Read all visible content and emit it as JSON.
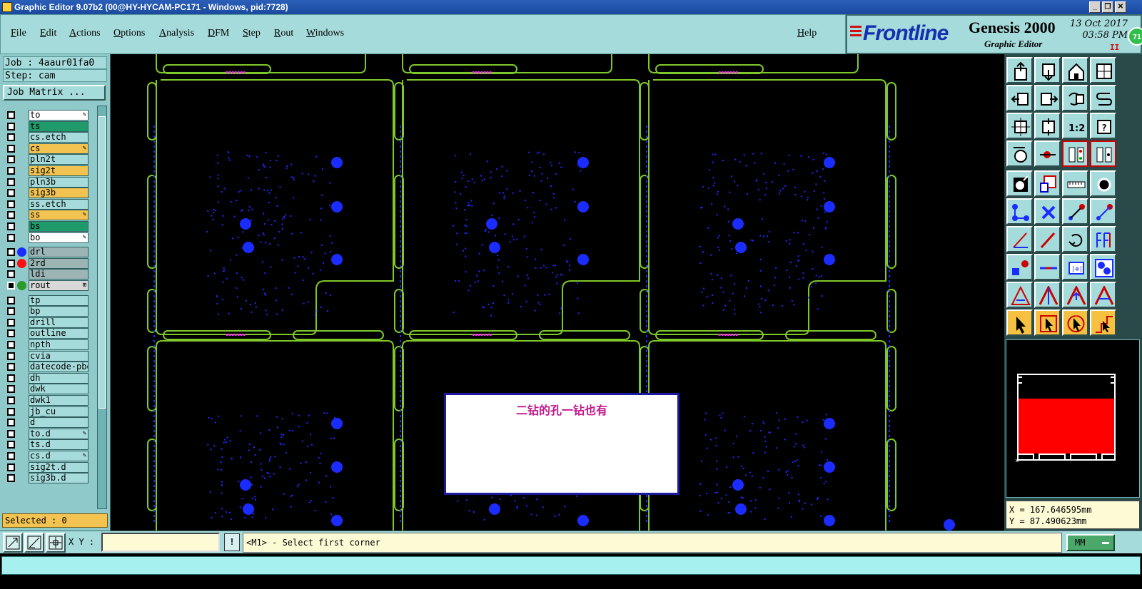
{
  "window": {
    "title": "Graphic Editor 9.07b2 (00@HY-HYCAM-PC171 - Windows, pid:7728)",
    "buttons": [
      "_",
      "❐",
      "✕"
    ]
  },
  "menu": {
    "items": [
      "File",
      "Edit",
      "Actions",
      "Options",
      "Analysis",
      "DFM",
      "Step",
      "Rout",
      "Windows"
    ],
    "help": "Help"
  },
  "brand": {
    "logo": "Frontline",
    "product": "Genesis 2000",
    "subtitle": "Graphic Editor",
    "date": "13 Oct 2017",
    "time": "03:58 PM",
    "pause": "II",
    "badge": "71"
  },
  "job": {
    "job_label": "Job : 4aaur01fa0",
    "step_label": "Step: cam",
    "matrix_button": "Job Matrix ..."
  },
  "layers": [
    {
      "name": "to",
      "bg": "#ffffff",
      "mark": "✎",
      "dot": ""
    },
    {
      "name": "ts",
      "bg": "#1f9a6a",
      "mark": "",
      "dot": ""
    },
    {
      "name": "cs.etch",
      "bg": "#a6dbdb",
      "mark": "",
      "dot": ""
    },
    {
      "name": "cs",
      "bg": "#f2c351",
      "mark": "✎",
      "dot": ""
    },
    {
      "name": "pln2t",
      "bg": "#a6dbdb",
      "mark": "",
      "dot": ""
    },
    {
      "name": "sig2t",
      "bg": "#f2c351",
      "mark": "",
      "dot": ""
    },
    {
      "name": "pln3b",
      "bg": "#a6dbdb",
      "mark": "",
      "dot": ""
    },
    {
      "name": "sig3b",
      "bg": "#f2c351",
      "mark": "",
      "dot": ""
    },
    {
      "name": "ss.etch",
      "bg": "#a6dbdb",
      "mark": "",
      "dot": ""
    },
    {
      "name": "ss",
      "bg": "#f2c351",
      "mark": "✎",
      "dot": ""
    },
    {
      "name": "bs",
      "bg": "#1f9a6a",
      "mark": "",
      "dot": ""
    },
    {
      "name": "bo",
      "bg": "#ffffff",
      "mark": "✎",
      "dot": ""
    },
    {
      "name": "drl",
      "bg": "#9cb4b4",
      "mark": "",
      "dot": "#1a2cff"
    },
    {
      "name": "2rd",
      "bg": "#9cb4b4",
      "mark": "",
      "dot": "#ff1010"
    },
    {
      "name": "ldi",
      "bg": "#9cb4b4",
      "mark": "",
      "dot": ""
    },
    {
      "name": "rout",
      "bg": "#d8d8d8",
      "mark": "⊞",
      "dot": "#2a9a2a"
    },
    {
      "name": "tp",
      "bg": "#a6dbdb",
      "mark": "",
      "dot": ""
    },
    {
      "name": "bp",
      "bg": "#a6dbdb",
      "mark": "",
      "dot": ""
    },
    {
      "name": "drill",
      "bg": "#a6dbdb",
      "mark": "",
      "dot": ""
    },
    {
      "name": "outline",
      "bg": "#a6dbdb",
      "mark": "",
      "dot": ""
    },
    {
      "name": "npth",
      "bg": "#a6dbdb",
      "mark": "",
      "dot": ""
    },
    {
      "name": "cvia",
      "bg": "#a6dbdb",
      "mark": "",
      "dot": ""
    },
    {
      "name": "datecode-pbe",
      "bg": "#a6dbdb",
      "mark": "",
      "dot": ""
    },
    {
      "name": "dh",
      "bg": "#a6dbdb",
      "mark": "",
      "dot": ""
    },
    {
      "name": "dwk",
      "bg": "#a6dbdb",
      "mark": "",
      "dot": ""
    },
    {
      "name": "dwk1",
      "bg": "#a6dbdb",
      "mark": "",
      "dot": ""
    },
    {
      "name": "jb_cu",
      "bg": "#a6dbdb",
      "mark": "",
      "dot": ""
    },
    {
      "name": "d",
      "bg": "#a6dbdb",
      "mark": "",
      "dot": ""
    },
    {
      "name": "to.d",
      "bg": "#a6dbdb",
      "mark": "✎",
      "dot": ""
    },
    {
      "name": "ts.d",
      "bg": "#a6dbdb",
      "mark": "",
      "dot": ""
    },
    {
      "name": "cs.d",
      "bg": "#a6dbdb",
      "mark": "✎",
      "dot": ""
    },
    {
      "name": "sig2t.d",
      "bg": "#a6dbdb",
      "mark": "",
      "dot": ""
    },
    {
      "name": "sig3b.d",
      "bg": "#a6dbdb",
      "mark": "",
      "dot": ""
    }
  ],
  "selected": "Selected : 0",
  "note": "二钻的孔一钻也有",
  "coords": {
    "x": "X = 167.646595mm",
    "y": "Y = 87.490623mm"
  },
  "bottom": {
    "xy_label": "X Y :",
    "xy_value": "",
    "excl": "!",
    "prompt": "<M1> - Select first corner",
    "units": "MM"
  },
  "colors": {
    "accent": "#a6dbdb",
    "rout": "#7ec82a",
    "pads": "#1a2cff",
    "note_text": "#c2188c",
    "minimap": "#ff0000"
  }
}
